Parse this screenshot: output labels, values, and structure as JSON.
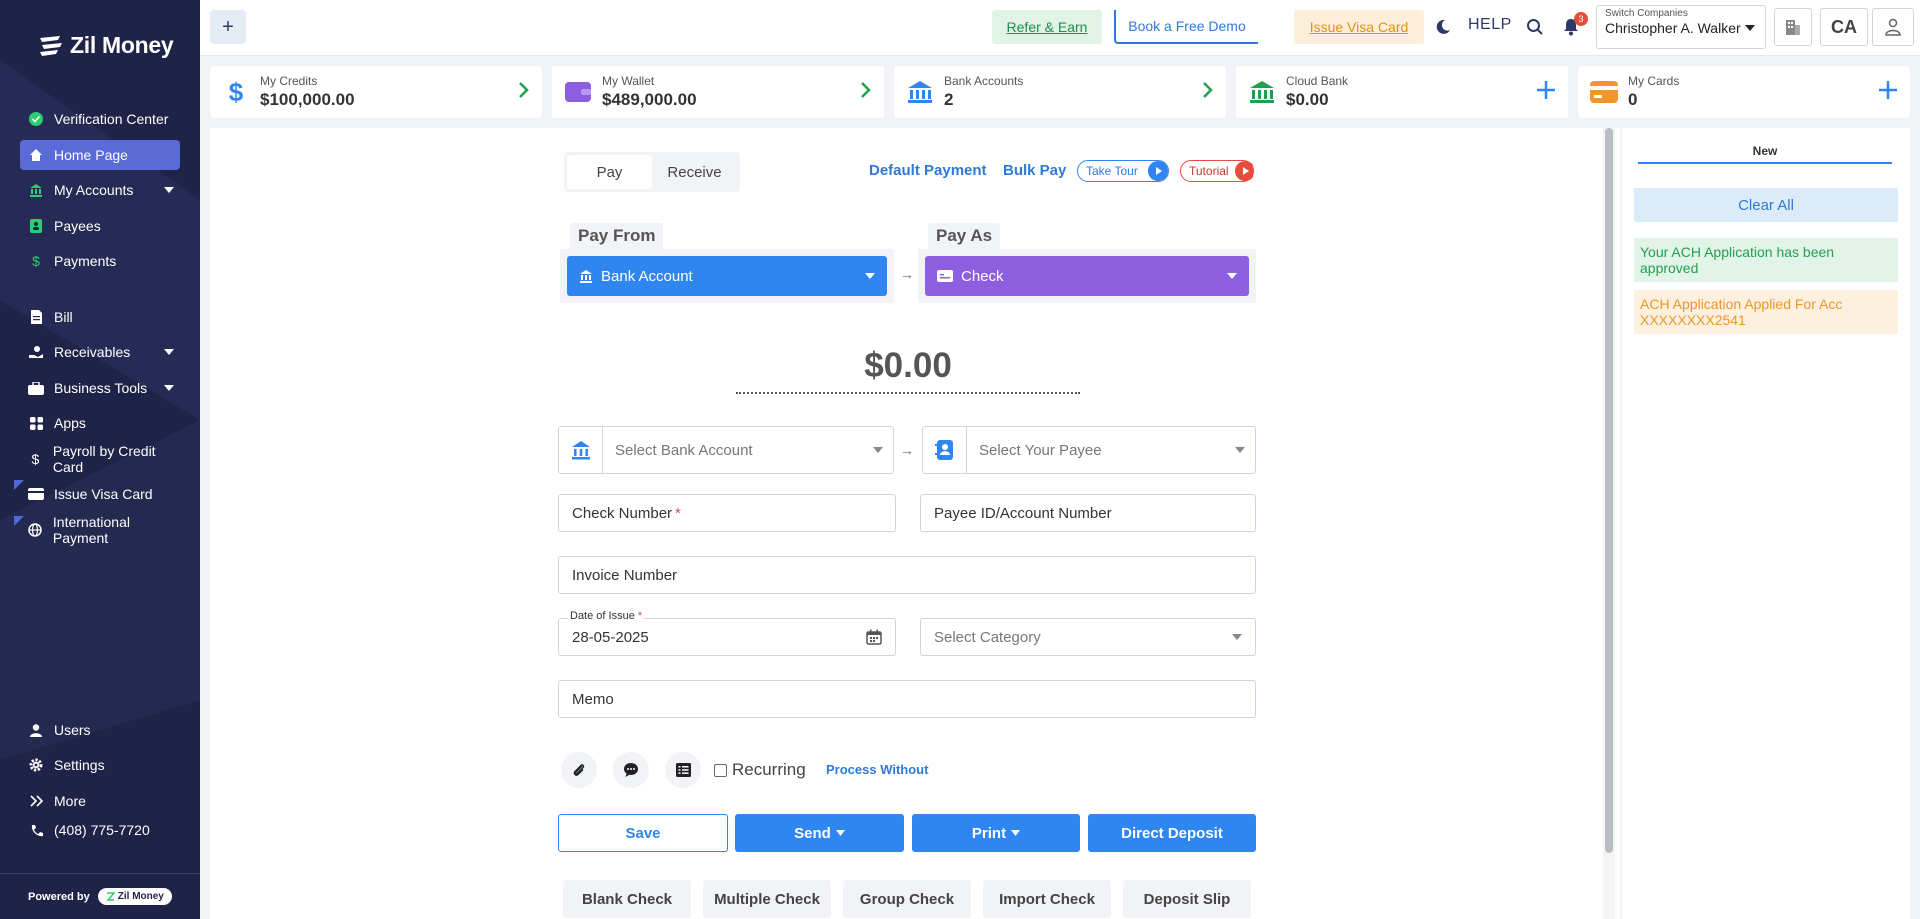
{
  "brand": {
    "name": "Zil Money",
    "powered_by": "Powered by",
    "powered_brand": "Zil Money"
  },
  "sidebar": {
    "items": [
      {
        "label": "Verification Center",
        "icon": "check-circle-icon"
      },
      {
        "label": "Home Page",
        "icon": "home-icon",
        "active": true
      },
      {
        "label": "My Accounts",
        "icon": "bank-icon"
      },
      {
        "label": "Payees",
        "icon": "contact-icon"
      },
      {
        "label": "Payments",
        "icon": "dollar-icon"
      },
      {
        "label": "Bill",
        "icon": "bill-icon"
      },
      {
        "label": "Receivables",
        "icon": "receive-icon"
      },
      {
        "label": "Business Tools",
        "icon": "briefcase-icon"
      },
      {
        "label": "Apps",
        "icon": "apps-icon"
      },
      {
        "label": "Payroll by Credit Card",
        "icon": "dollar-icon"
      },
      {
        "label": "Issue Visa Card",
        "icon": "card-icon"
      },
      {
        "label": "International Payment",
        "icon": "globe-icon"
      }
    ],
    "bottom_items": [
      {
        "label": "Users",
        "icon": "user-icon"
      },
      {
        "label": "Settings",
        "icon": "gear-icon"
      },
      {
        "label": "More",
        "icon": "double-chevron-icon"
      },
      {
        "label": "(408) 775-7720",
        "icon": "phone-icon"
      }
    ]
  },
  "topbar": {
    "plus": "+",
    "refer": "Refer & Earn",
    "demo": "Book a Free Demo",
    "issue_visa": "Issue Visa Card",
    "help": "HELP",
    "notification_count": "3",
    "switch_label": "Switch Companies",
    "company": "Christopher A. Walker",
    "initials": "CA"
  },
  "cards": [
    {
      "title": "My Credits",
      "value": "$100,000.00",
      "action": "arrow",
      "color": "#2f86f0"
    },
    {
      "title": "My Wallet",
      "value": "$489,000.00",
      "action": "arrow",
      "color": "#8e5ee0"
    },
    {
      "title": "Bank Accounts",
      "value": "2",
      "action": "arrow",
      "color": "#2f86f0"
    },
    {
      "title": "Cloud Bank",
      "value": "$0.00",
      "action": "plus",
      "color": "#1fa04f"
    },
    {
      "title": "My Cards",
      "value": "0",
      "action": "plus",
      "color": "#f0962a"
    }
  ],
  "payment": {
    "tab_pay": "Pay",
    "tab_receive": "Receive",
    "default_payment": "Default Payment",
    "bulk_pay": "Bulk Pay",
    "take_tour": "Take Tour",
    "tutorial": "Tutorial",
    "pay_from_label": "Pay From",
    "pay_from_value": "Bank Account",
    "pay_as_label": "Pay As",
    "pay_as_value": "Check",
    "amount": "$0.00",
    "bank_placeholder": "Select Bank Account",
    "payee_placeholder": "Select Your Payee",
    "check_number": "Check Number",
    "payee_id": "Payee ID/Account Number",
    "invoice_number": "Invoice Number",
    "date_label": "Date of Issue",
    "date_value": "28-05-2025",
    "category_placeholder": "Select Category",
    "memo": "Memo",
    "recurring": "Recurring",
    "process_without": "Process Without",
    "required_mark": "*",
    "arrow": "→"
  },
  "actions": {
    "save": "Save",
    "send": "Send",
    "print": "Print",
    "direct_deposit": "Direct Deposit"
  },
  "bottom_tabs": [
    "Blank Check",
    "Multiple Check",
    "Group Check",
    "Import Check",
    "Deposit Slip"
  ],
  "notifications": {
    "tab": "New",
    "clear_all": "Clear All",
    "items": [
      {
        "text": "Your ACH Application has been approved",
        "status": "success"
      },
      {
        "text": "ACH Application Applied For Acc XXXXXXXX2541",
        "status": "warning"
      }
    ]
  },
  "colors": {
    "sidebar": "#1f2347",
    "accent": "#2f86f0",
    "pay_from": "#2f86f0",
    "pay_as": "#8e5ee0",
    "active_nav": "#5a6bd8"
  }
}
